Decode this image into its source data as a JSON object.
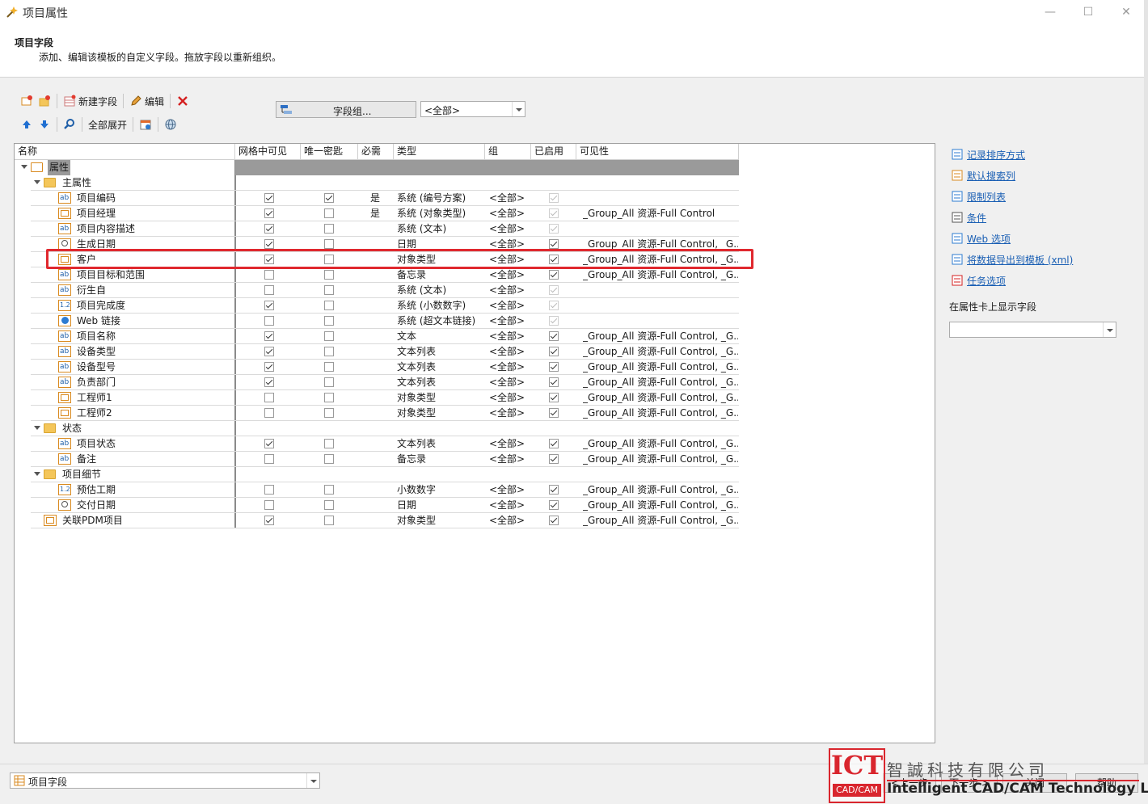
{
  "window": {
    "title": "项目属性",
    "min": "—",
    "max": "☐",
    "close": "✕"
  },
  "header": {
    "title": "项目字段",
    "subtitle": "添加、编辑该模板的自定义字段。拖放字段以重新组织。"
  },
  "toolbar": {
    "new_field": "新建字段",
    "edit": "编辑",
    "expand_all": "全部展开",
    "field_group": "字段组...",
    "group_filter": "<全部>"
  },
  "columns": [
    "名称",
    "网格中可见",
    "唯一密匙",
    "必需",
    "类型",
    "组",
    "已启用",
    "可见性"
  ],
  "rows": [
    {
      "name": "属性",
      "level": 0,
      "kind": "folder-open",
      "grid": null,
      "unique": null,
      "required": "",
      "type": "",
      "group": "",
      "enabled": null,
      "visibility": "",
      "selected": true
    },
    {
      "name": "主属性",
      "level": 1,
      "kind": "folder",
      "grid": null,
      "unique": null,
      "required": "",
      "type": "",
      "group": "",
      "enabled": null,
      "visibility": ""
    },
    {
      "name": "项目编码",
      "level": 2,
      "kind": "text",
      "grid": true,
      "unique": true,
      "required": "是",
      "type": "系统 (编号方案)",
      "group": "<全部>",
      "enabled": "disabled-checked",
      "visibility": ""
    },
    {
      "name": "项目经理",
      "level": 2,
      "kind": "object",
      "grid": true,
      "unique": false,
      "required": "是",
      "type": "系统 (对象类型)",
      "group": "<全部>",
      "enabled": "disabled-checked",
      "visibility": "_Group_All 资源-Full Control"
    },
    {
      "name": "项目内容描述",
      "level": 2,
      "kind": "text",
      "grid": true,
      "unique": false,
      "required": "",
      "type": "系统 (文本)",
      "group": "<全部>",
      "enabled": "disabled-checked",
      "visibility": ""
    },
    {
      "name": "生成日期",
      "level": 2,
      "kind": "date",
      "grid": true,
      "unique": false,
      "required": "",
      "type": "日期",
      "group": "<全部>",
      "enabled": true,
      "visibility": "_Group_All 资源-Full Control, _G..."
    },
    {
      "name": "客户",
      "level": 2,
      "kind": "object",
      "grid": true,
      "unique": false,
      "required": "",
      "type": "对象类型",
      "group": "<全部>",
      "enabled": true,
      "visibility": "_Group_All 资源-Full Control, _G..."
    },
    {
      "name": "项目目标和范围",
      "level": 2,
      "kind": "text",
      "grid": false,
      "unique": false,
      "required": "",
      "type": "备忘录",
      "group": "<全部>",
      "enabled": true,
      "visibility": "_Group_All 资源-Full Control, _G..."
    },
    {
      "name": "衍生自",
      "level": 2,
      "kind": "text",
      "grid": false,
      "unique": false,
      "required": "",
      "type": "系统 (文本)",
      "group": "<全部>",
      "enabled": "disabled-checked",
      "visibility": ""
    },
    {
      "name": "项目完成度",
      "level": 2,
      "kind": "number",
      "grid": true,
      "unique": false,
      "required": "",
      "type": "系统 (小数数字)",
      "group": "<全部>",
      "enabled": "disabled-checked",
      "visibility": ""
    },
    {
      "name": "Web 链接",
      "level": 2,
      "kind": "web",
      "grid": false,
      "unique": false,
      "required": "",
      "type": "系统 (超文本链接)",
      "group": "<全部>",
      "enabled": "disabled-checked",
      "visibility": ""
    },
    {
      "name": "项目名称",
      "level": 2,
      "kind": "text",
      "grid": true,
      "unique": false,
      "required": "",
      "type": "文本",
      "group": "<全部>",
      "enabled": true,
      "visibility": "_Group_All 资源-Full Control, _G..."
    },
    {
      "name": "设备类型",
      "level": 2,
      "kind": "text",
      "grid": true,
      "unique": false,
      "required": "",
      "type": "文本列表",
      "group": "<全部>",
      "enabled": true,
      "visibility": "_Group_All 资源-Full Control, _G..."
    },
    {
      "name": "设备型号",
      "level": 2,
      "kind": "text",
      "grid": true,
      "unique": false,
      "required": "",
      "type": "文本列表",
      "group": "<全部>",
      "enabled": true,
      "visibility": "_Group_All 资源-Full Control, _G..."
    },
    {
      "name": "负责部门",
      "level": 2,
      "kind": "text",
      "grid": true,
      "unique": false,
      "required": "",
      "type": "文本列表",
      "group": "<全部>",
      "enabled": true,
      "visibility": "_Group_All 资源-Full Control, _G..."
    },
    {
      "name": "工程师1",
      "level": 2,
      "kind": "object",
      "grid": false,
      "unique": false,
      "required": "",
      "type": "对象类型",
      "group": "<全部>",
      "enabled": true,
      "visibility": "_Group_All 资源-Full Control, _G..."
    },
    {
      "name": "工程师2",
      "level": 2,
      "kind": "object",
      "grid": false,
      "unique": false,
      "required": "",
      "type": "对象类型",
      "group": "<全部>",
      "enabled": true,
      "visibility": "_Group_All 资源-Full Control, _G..."
    },
    {
      "name": "状态",
      "level": 1,
      "kind": "folder",
      "grid": null,
      "unique": null,
      "required": "",
      "type": "",
      "group": "",
      "enabled": null,
      "visibility": ""
    },
    {
      "name": "项目状态",
      "level": 2,
      "kind": "text",
      "grid": true,
      "unique": false,
      "required": "",
      "type": "文本列表",
      "group": "<全部>",
      "enabled": true,
      "visibility": "_Group_All 资源-Full Control, _G..."
    },
    {
      "name": "备注",
      "level": 2,
      "kind": "text",
      "grid": false,
      "unique": false,
      "required": "",
      "type": "备忘录",
      "group": "<全部>",
      "enabled": true,
      "visibility": "_Group_All 资源-Full Control, _G..."
    },
    {
      "name": "项目细节",
      "level": 1,
      "kind": "folder",
      "grid": null,
      "unique": null,
      "required": "",
      "type": "",
      "group": "",
      "enabled": null,
      "visibility": ""
    },
    {
      "name": "预估工期",
      "level": 2,
      "kind": "number",
      "grid": false,
      "unique": false,
      "required": "",
      "type": "小数数字",
      "group": "<全部>",
      "enabled": true,
      "visibility": "_Group_All 资源-Full Control, _G..."
    },
    {
      "name": "交付日期",
      "level": 2,
      "kind": "date",
      "grid": false,
      "unique": false,
      "required": "",
      "type": "日期",
      "group": "<全部>",
      "enabled": true,
      "visibility": "_Group_All 资源-Full Control, _G..."
    },
    {
      "name": "关联PDM项目",
      "level": 1,
      "kind": "object",
      "grid": true,
      "unique": false,
      "required": "",
      "type": "对象类型",
      "group": "<全部>",
      "enabled": true,
      "visibility": "_Group_All 资源-Full Control, _G..."
    }
  ],
  "right_panel": {
    "links": [
      "记录排序方式",
      "默认搜索列",
      "限制列表",
      "条件",
      "Web 选项",
      "将数据导出到模板 (xml)",
      "任务选项"
    ],
    "card_label": "在属性卡上显示字段",
    "card_value": ""
  },
  "bottom": {
    "page_select": "项目字段",
    "prev": "<上一步",
    "next": "下一步 >",
    "close": "关闭",
    "help": "帮助"
  },
  "watermark": {
    "logo": "ICT",
    "logo_sub": "CAD/CAM",
    "company_cn": "智誠科技有限公司",
    "company_en": "Intelligent CAD/CAM Technology Ltd."
  },
  "colors": {
    "highlight": "#e0282e",
    "link": "#1a5fb4",
    "selected_row": "#9a9a9a",
    "folder": "#f4c65a",
    "object_icon": "#d98a1f"
  }
}
